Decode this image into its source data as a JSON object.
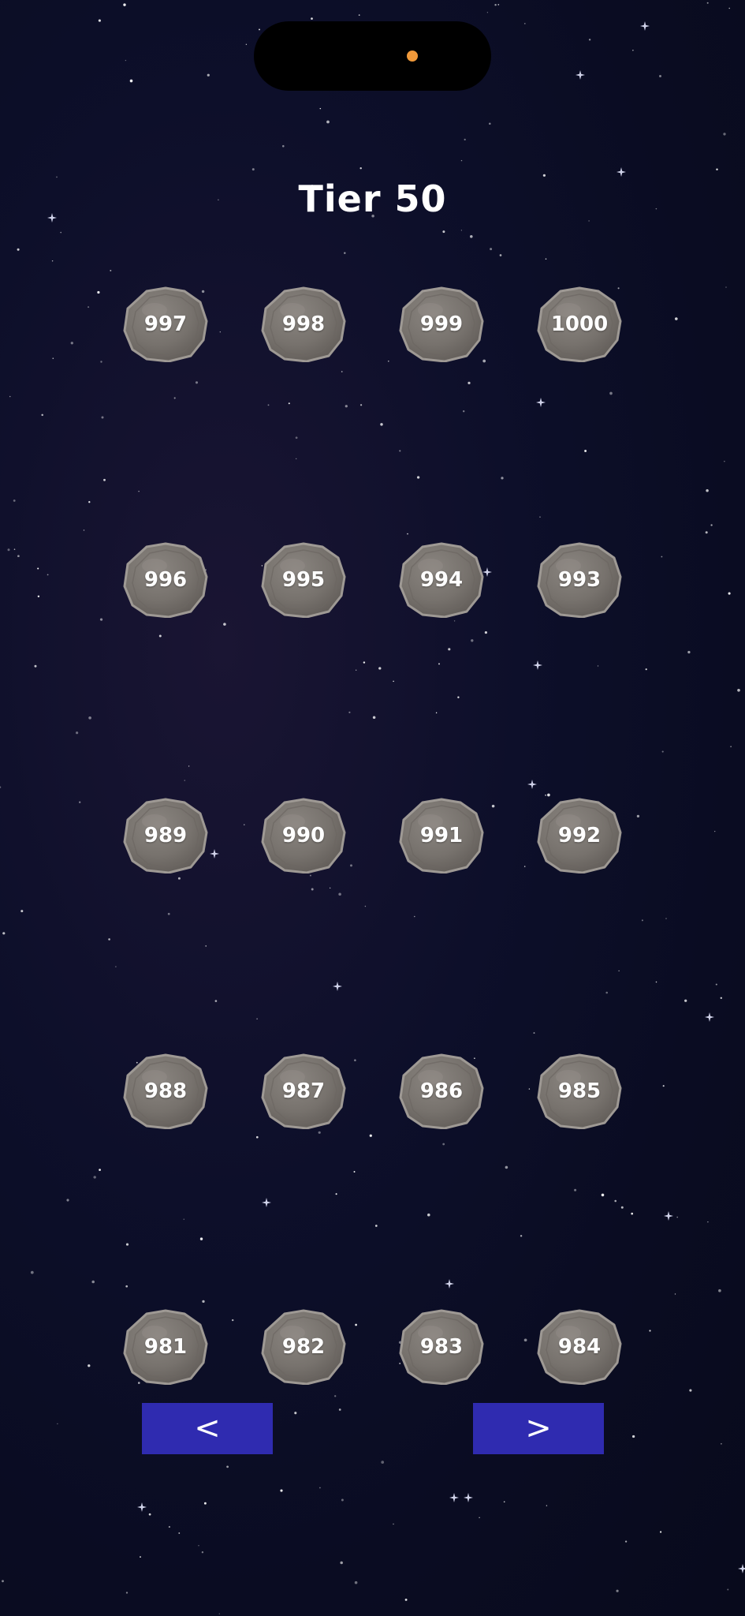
{
  "page": {
    "title": "Tier 50"
  },
  "levels": {
    "row1": [
      "997",
      "998",
      "999",
      "1000"
    ],
    "row2": [
      "996",
      "995",
      "994",
      "993"
    ],
    "row3": [
      "989",
      "990",
      "991",
      "992"
    ],
    "row4": [
      "988",
      "987",
      "986",
      "985"
    ],
    "row5": [
      "981",
      "982",
      "983",
      "984"
    ]
  },
  "navigation": {
    "prev_label": "<",
    "next_label": ">"
  },
  "colors": {
    "background": "#0b0d24",
    "rock": "#7a7570",
    "button": "#2f2bb0",
    "camera_dot": "#f0993a"
  },
  "icons": {
    "level_marker": "rock-icon",
    "prev": "chevron-left",
    "next": "chevron-right"
  }
}
